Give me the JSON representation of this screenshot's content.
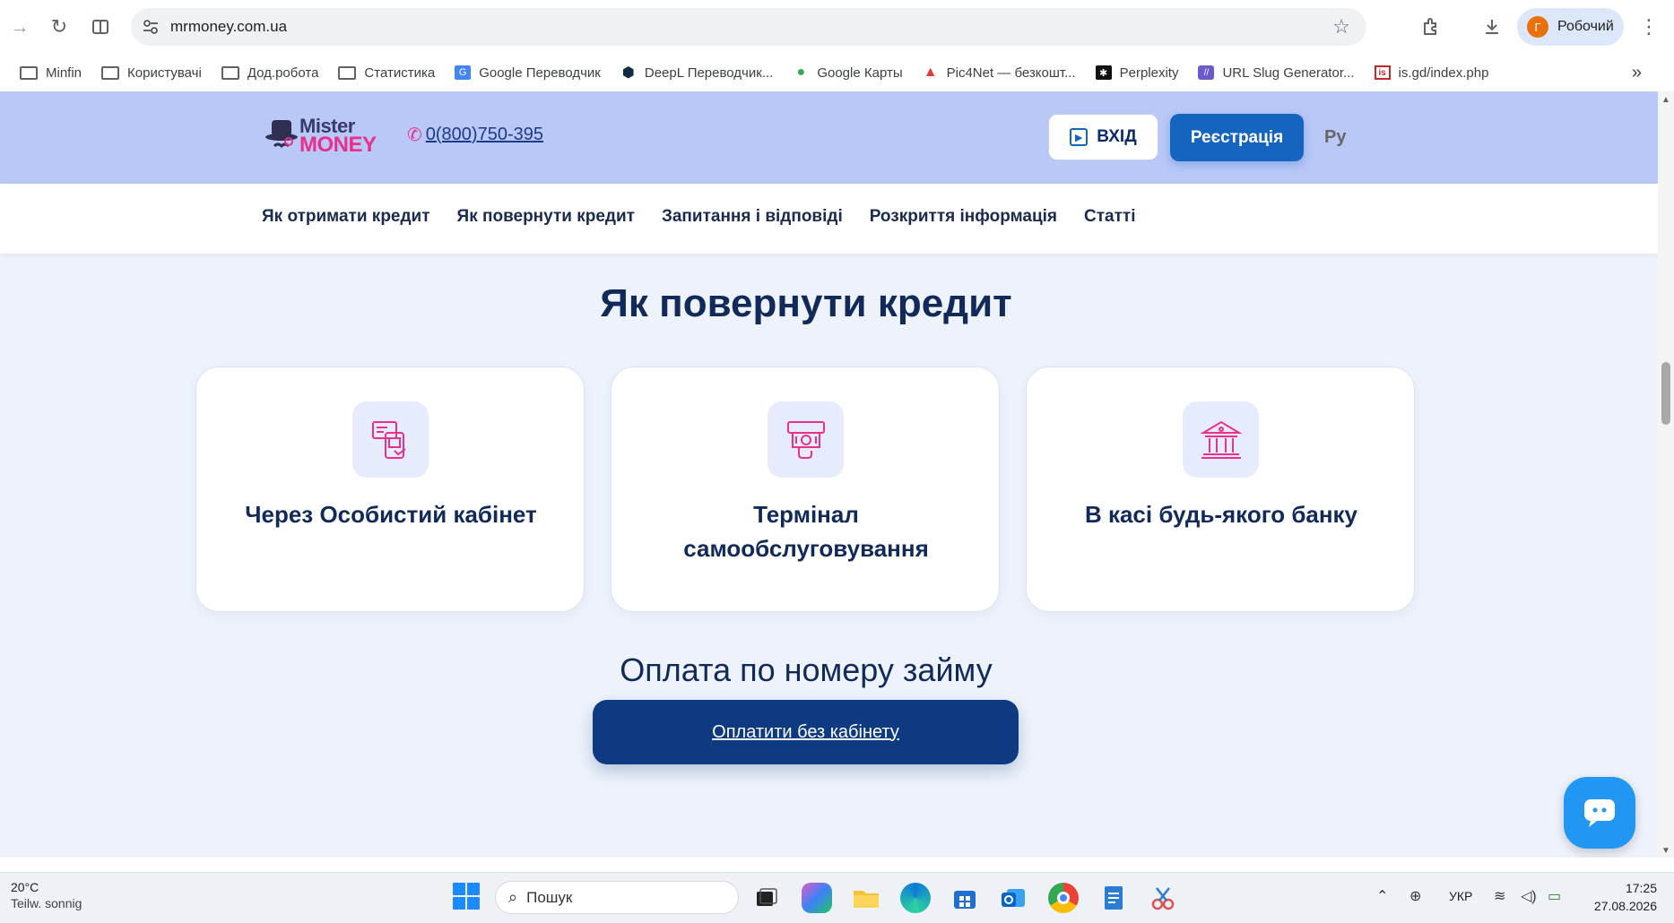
{
  "browser": {
    "url": "mrmoney.com.ua",
    "profile_initial": "Г",
    "profile_name": "Робочий"
  },
  "bookmarks": [
    {
      "label": "Minfin",
      "icon": "folder-icon"
    },
    {
      "label": "Користувачі",
      "icon": "folder-icon"
    },
    {
      "label": "Дод.робота",
      "icon": "folder-icon"
    },
    {
      "label": "Статистика",
      "icon": "folder-icon"
    },
    {
      "label": "Google Переводчик",
      "icon": "google-translate-icon"
    },
    {
      "label": "DeepL Переводчик...",
      "icon": "deepl-icon"
    },
    {
      "label": "Google Карты",
      "icon": "google-maps-icon"
    },
    {
      "label": "Pic4Net — безкошт...",
      "icon": "pic4net-icon"
    },
    {
      "label": "Perplexity",
      "icon": "perplexity-icon"
    },
    {
      "label": "URL Slug Generator...",
      "icon": "url-slug-icon"
    },
    {
      "label": "is.gd/index.php",
      "icon": "isgd-icon"
    }
  ],
  "site": {
    "logo_top": "Mister",
    "logo_bottom": "MONEY",
    "phone": "0(800)750-395",
    "login_label": "ВХІД",
    "register_label": "Реєстрація",
    "lang_label": "Ру",
    "nav": [
      "Як отримати кредит",
      "Як повернути кредит",
      "Запитання і відповіді",
      "Розкриття інформація",
      "Статті"
    ],
    "section_title": "Як повернути кредит",
    "cards": [
      {
        "title": "Через Особистий кабінет",
        "icon": "phone-payment-icon"
      },
      {
        "title": "Термінал самообслуговування",
        "icon": "atm-terminal-icon"
      },
      {
        "title": "В касі будь-якого банку",
        "icon": "bank-icon"
      }
    ],
    "pay_title": "Оплата по номеру займу",
    "pay_button": "Оплатити без кабінету"
  },
  "colors": {
    "header_bg": "#b9c8f7",
    "brand_pink": "#e8308c",
    "primary_blue": "#1565c0",
    "dark_navy": "#0d3a80",
    "page_bg": "#eef3fb"
  },
  "taskbar": {
    "weather_temp": "20°C",
    "weather_desc": "Teilw. sonnig",
    "search_placeholder": "Пошук",
    "lang": "УКР",
    "time": "17:25",
    "date": "27.08.2026"
  }
}
